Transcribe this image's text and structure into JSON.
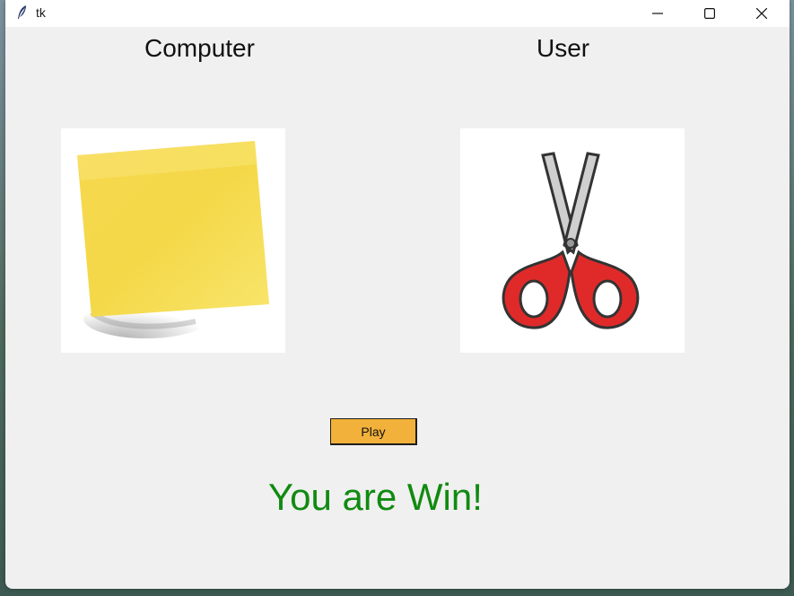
{
  "window": {
    "title": "tk",
    "controls": {
      "minimize_icon": "minimize-icon",
      "maximize_icon": "maximize-icon",
      "close_icon": "close-icon"
    }
  },
  "labels": {
    "computer": "Computer",
    "user": "User"
  },
  "images": {
    "computer_choice": "paper (sticky note)",
    "user_choice": "scissors"
  },
  "play_button": {
    "label": "Play"
  },
  "result": {
    "text": "You are Win!"
  },
  "colors": {
    "window_bg": "#f0f0f0",
    "button_bg": "#f2b13a",
    "result_text": "#118a11"
  }
}
